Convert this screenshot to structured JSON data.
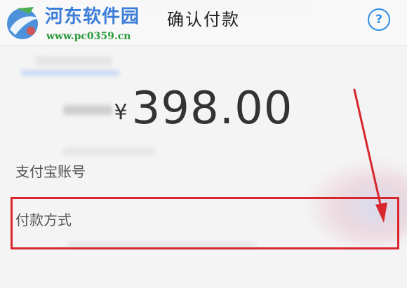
{
  "header": {
    "title": "确认付款",
    "help_icon_glyph": "?"
  },
  "watermark": {
    "site_name": "河东软件园",
    "url": "www.pc0359.cn"
  },
  "payment": {
    "currency_symbol": "¥",
    "amount": "398.00"
  },
  "rows": [
    {
      "label": "支付宝账号"
    },
    {
      "label": "付款方式"
    }
  ],
  "annotation": {
    "highlight_color": "#d8262f",
    "arrow_color": "#d8262f"
  },
  "theme": {
    "accent": "#2f8ee4",
    "watermark_title_color": "#3b7dd8",
    "watermark_url_color": "#2a9a3c"
  }
}
